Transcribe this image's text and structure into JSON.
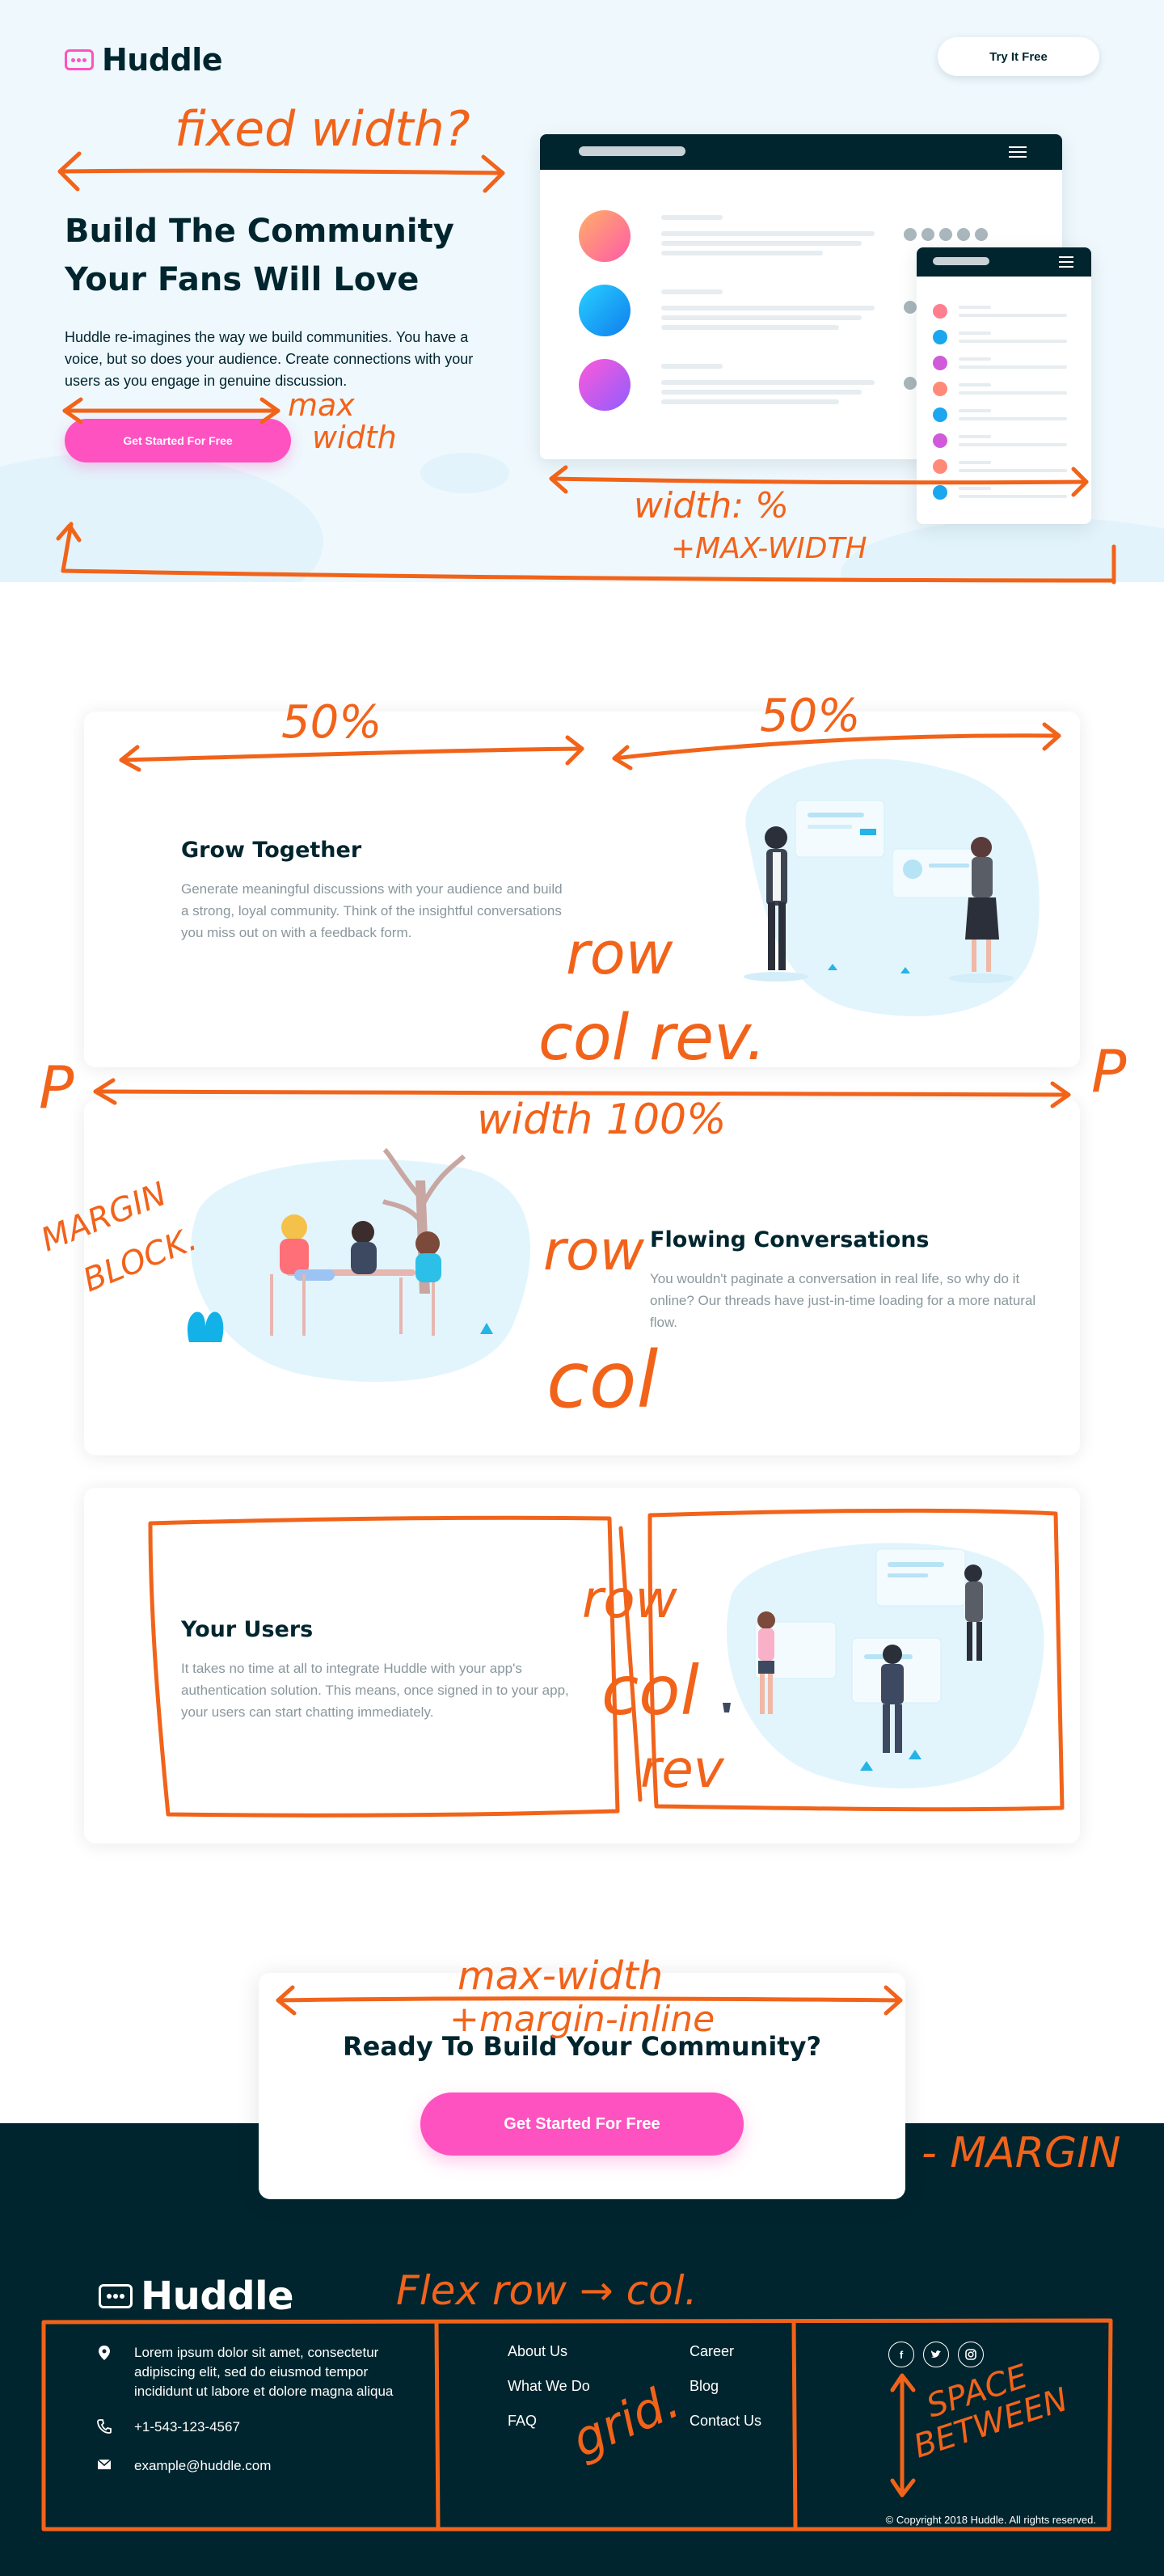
{
  "brand": {
    "name": "Huddle"
  },
  "header": {
    "try_label": "Try It Free"
  },
  "hero": {
    "title_line1": "Build The Community",
    "title_line2": "Your Fans Will Love",
    "description": "Huddle re-imagines the way we build communities. You have a voice, but so does your audience. Create connections with your users as you engage in genuine discussion.",
    "cta_label": "Get Started For Free"
  },
  "features": [
    {
      "title": "Grow Together",
      "text": "Generate meaningful discussions with your audience and build a strong, loyal community. Think of the insightful conversations you miss out on with a feedback form."
    },
    {
      "title": "Flowing Conversations",
      "text": "You wouldn't paginate a conversation in real life, so why do it online? Our threads have just-in-time loading for a more natural flow."
    },
    {
      "title": "Your Users",
      "text": "It takes no time at all to integrate Huddle with your app's authentication solution. This means, once signed in to your app, your users can start chatting immediately."
    }
  ],
  "cta": {
    "title": "Ready To Build Your Community?",
    "button_label": "Get Started For Free"
  },
  "footer": {
    "address": "Lorem ipsum dolor sit amet, consectetur adipiscing elit, sed do eiusmod tempor incididunt ut labore et dolore magna aliqua",
    "phone": "+1-543-123-4567",
    "email": "example@huddle.com",
    "links_col1": [
      "About Us",
      "What We Do",
      "FAQ"
    ],
    "links_col2": [
      "Career",
      "Blog",
      "Contact Us"
    ],
    "copyright": "© Copyright 2018 Huddle. All rights reserved."
  },
  "annotations": {
    "fixed_width": "fixed width?",
    "max_width_1": "max",
    "max_width_2": "width",
    "width_pct_1": "width: %",
    "width_pct_2": "+MAX-WIDTH",
    "fifty_left": "50%",
    "fifty_right": "50%",
    "row_1": "row",
    "col_rev": "col rev.",
    "p_left": "P",
    "p_right": "P",
    "width_100": "width 100%",
    "margin_block_1": "MARGIN",
    "margin_block_2": "BLOCK.",
    "row_2": "row",
    "col_2": "col",
    "row_3": "row",
    "col_3": "col",
    "rev_3": "rev",
    "max_width_cta": "max-width",
    "margin_inline": "+margin-inline",
    "neg_margin": "- MARGIN",
    "flex_row_col": "Flex row → col.",
    "grid": "grid.",
    "space_1": "SPACE",
    "space_2": "BETWEEN"
  },
  "colors": {
    "dark": "#00252e",
    "pink": "#ff52c1",
    "hero_bg": "#eef8fd",
    "annotation": "#f2631a"
  },
  "icons": [
    "chat-bubble-icon",
    "menu-icon",
    "location-pin-icon",
    "phone-icon",
    "mail-icon",
    "facebook-icon",
    "twitter-icon",
    "instagram-icon"
  ]
}
